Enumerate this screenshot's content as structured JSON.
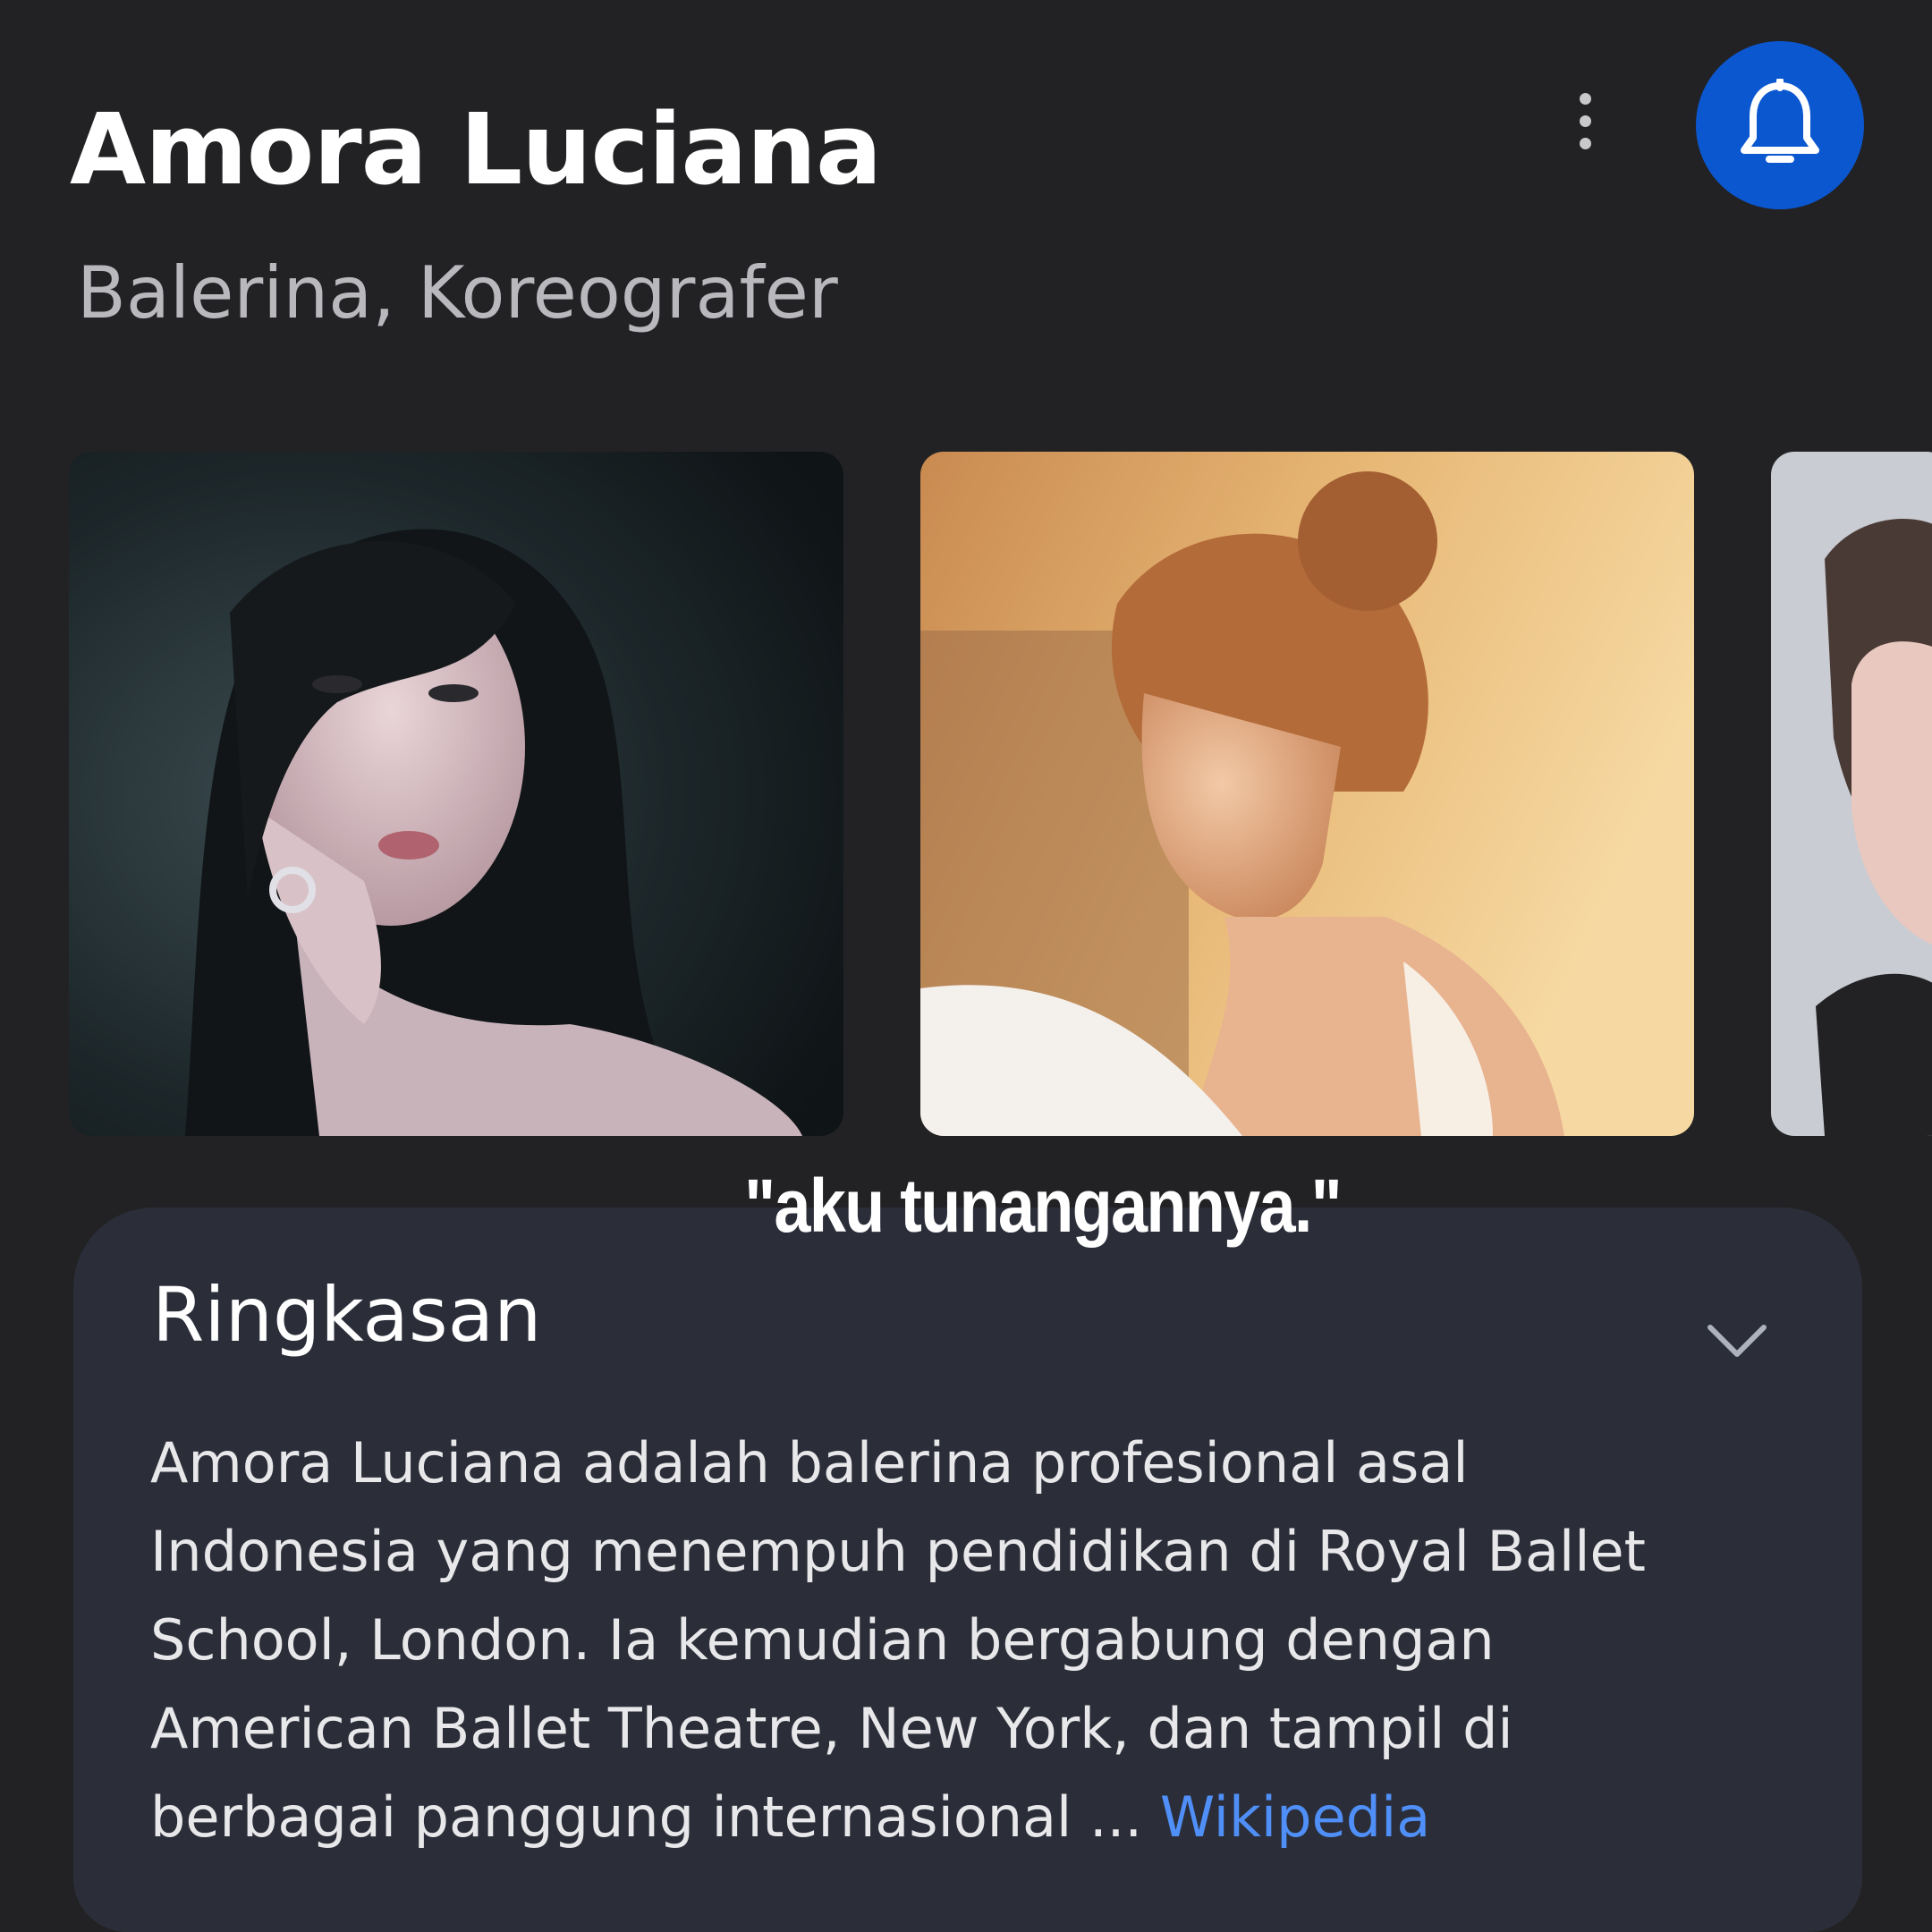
{
  "header": {
    "title": "Amora Luciana",
    "subtitle": "Balerina, Koreografer",
    "more_icon": "more-vert-icon",
    "bell_icon": "bell-icon",
    "accent_color": "#0b57d0"
  },
  "caption": "\"aku tunangannya.\"",
  "summary": {
    "title": "Ringkasan",
    "chevron_icon": "chevron-down-icon",
    "lines": [
      "Amora Luciana adalah balerina profesional asal",
      "Indonesia yang menempuh pendidikan di Royal Ballet",
      "School, London. Ia kemudian bergabung dengan",
      "American Ballet Theatre, New York, dan tampil di",
      "berbagai panggung internasional ..."
    ],
    "source_link": "Wikipedia",
    "link_color": "#4f8ff7"
  }
}
